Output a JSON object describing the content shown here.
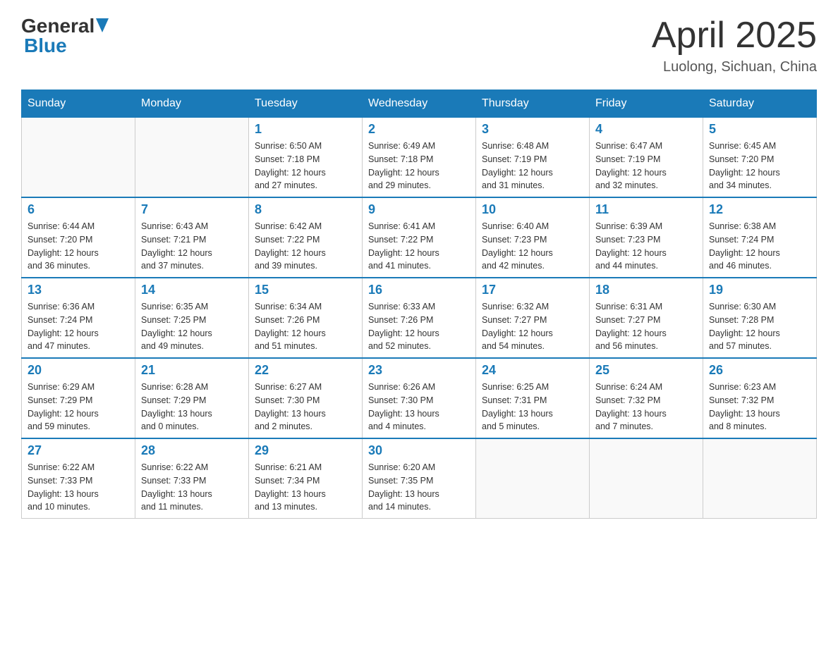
{
  "header": {
    "logo": {
      "general": "General",
      "blue": "Blue",
      "arrow_color": "#1a7ab8"
    },
    "title": "April 2025",
    "location": "Luolong, Sichuan, China"
  },
  "days_of_week": [
    "Sunday",
    "Monday",
    "Tuesday",
    "Wednesday",
    "Thursday",
    "Friday",
    "Saturday"
  ],
  "weeks": [
    [
      {
        "day": "",
        "info": ""
      },
      {
        "day": "",
        "info": ""
      },
      {
        "day": "1",
        "info": "Sunrise: 6:50 AM\nSunset: 7:18 PM\nDaylight: 12 hours\nand 27 minutes."
      },
      {
        "day": "2",
        "info": "Sunrise: 6:49 AM\nSunset: 7:18 PM\nDaylight: 12 hours\nand 29 minutes."
      },
      {
        "day": "3",
        "info": "Sunrise: 6:48 AM\nSunset: 7:19 PM\nDaylight: 12 hours\nand 31 minutes."
      },
      {
        "day": "4",
        "info": "Sunrise: 6:47 AM\nSunset: 7:19 PM\nDaylight: 12 hours\nand 32 minutes."
      },
      {
        "day": "5",
        "info": "Sunrise: 6:45 AM\nSunset: 7:20 PM\nDaylight: 12 hours\nand 34 minutes."
      }
    ],
    [
      {
        "day": "6",
        "info": "Sunrise: 6:44 AM\nSunset: 7:20 PM\nDaylight: 12 hours\nand 36 minutes."
      },
      {
        "day": "7",
        "info": "Sunrise: 6:43 AM\nSunset: 7:21 PM\nDaylight: 12 hours\nand 37 minutes."
      },
      {
        "day": "8",
        "info": "Sunrise: 6:42 AM\nSunset: 7:22 PM\nDaylight: 12 hours\nand 39 minutes."
      },
      {
        "day": "9",
        "info": "Sunrise: 6:41 AM\nSunset: 7:22 PM\nDaylight: 12 hours\nand 41 minutes."
      },
      {
        "day": "10",
        "info": "Sunrise: 6:40 AM\nSunset: 7:23 PM\nDaylight: 12 hours\nand 42 minutes."
      },
      {
        "day": "11",
        "info": "Sunrise: 6:39 AM\nSunset: 7:23 PM\nDaylight: 12 hours\nand 44 minutes."
      },
      {
        "day": "12",
        "info": "Sunrise: 6:38 AM\nSunset: 7:24 PM\nDaylight: 12 hours\nand 46 minutes."
      }
    ],
    [
      {
        "day": "13",
        "info": "Sunrise: 6:36 AM\nSunset: 7:24 PM\nDaylight: 12 hours\nand 47 minutes."
      },
      {
        "day": "14",
        "info": "Sunrise: 6:35 AM\nSunset: 7:25 PM\nDaylight: 12 hours\nand 49 minutes."
      },
      {
        "day": "15",
        "info": "Sunrise: 6:34 AM\nSunset: 7:26 PM\nDaylight: 12 hours\nand 51 minutes."
      },
      {
        "day": "16",
        "info": "Sunrise: 6:33 AM\nSunset: 7:26 PM\nDaylight: 12 hours\nand 52 minutes."
      },
      {
        "day": "17",
        "info": "Sunrise: 6:32 AM\nSunset: 7:27 PM\nDaylight: 12 hours\nand 54 minutes."
      },
      {
        "day": "18",
        "info": "Sunrise: 6:31 AM\nSunset: 7:27 PM\nDaylight: 12 hours\nand 56 minutes."
      },
      {
        "day": "19",
        "info": "Sunrise: 6:30 AM\nSunset: 7:28 PM\nDaylight: 12 hours\nand 57 minutes."
      }
    ],
    [
      {
        "day": "20",
        "info": "Sunrise: 6:29 AM\nSunset: 7:29 PM\nDaylight: 12 hours\nand 59 minutes."
      },
      {
        "day": "21",
        "info": "Sunrise: 6:28 AM\nSunset: 7:29 PM\nDaylight: 13 hours\nand 0 minutes."
      },
      {
        "day": "22",
        "info": "Sunrise: 6:27 AM\nSunset: 7:30 PM\nDaylight: 13 hours\nand 2 minutes."
      },
      {
        "day": "23",
        "info": "Sunrise: 6:26 AM\nSunset: 7:30 PM\nDaylight: 13 hours\nand 4 minutes."
      },
      {
        "day": "24",
        "info": "Sunrise: 6:25 AM\nSunset: 7:31 PM\nDaylight: 13 hours\nand 5 minutes."
      },
      {
        "day": "25",
        "info": "Sunrise: 6:24 AM\nSunset: 7:32 PM\nDaylight: 13 hours\nand 7 minutes."
      },
      {
        "day": "26",
        "info": "Sunrise: 6:23 AM\nSunset: 7:32 PM\nDaylight: 13 hours\nand 8 minutes."
      }
    ],
    [
      {
        "day": "27",
        "info": "Sunrise: 6:22 AM\nSunset: 7:33 PM\nDaylight: 13 hours\nand 10 minutes."
      },
      {
        "day": "28",
        "info": "Sunrise: 6:22 AM\nSunset: 7:33 PM\nDaylight: 13 hours\nand 11 minutes."
      },
      {
        "day": "29",
        "info": "Sunrise: 6:21 AM\nSunset: 7:34 PM\nDaylight: 13 hours\nand 13 minutes."
      },
      {
        "day": "30",
        "info": "Sunrise: 6:20 AM\nSunset: 7:35 PM\nDaylight: 13 hours\nand 14 minutes."
      },
      {
        "day": "",
        "info": ""
      },
      {
        "day": "",
        "info": ""
      },
      {
        "day": "",
        "info": ""
      }
    ]
  ]
}
